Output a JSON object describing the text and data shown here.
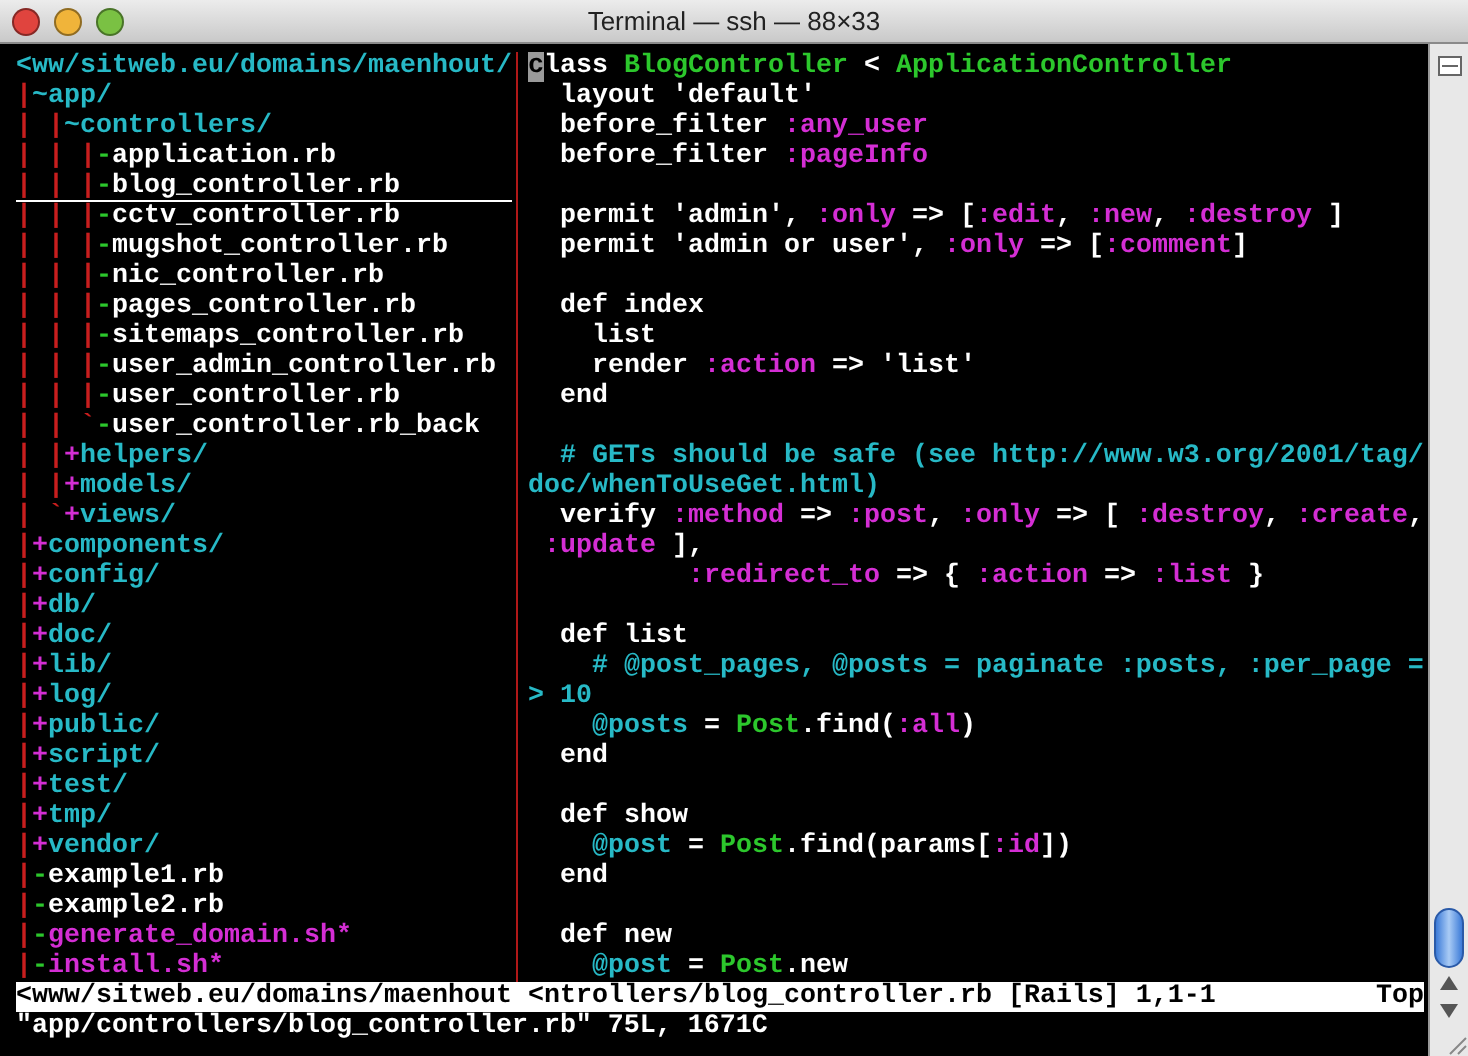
{
  "window": {
    "title": "Terminal — ssh — 88×33"
  },
  "tree_pane": {
    "lines": [
      {
        "cursor_line": false,
        "segments": [
          {
            "text": "<ww/sitweb.eu/domains/maenhout/",
            "color": "#27b9c6"
          }
        ]
      },
      {
        "cursor_line": false,
        "segments": [
          {
            "text": "|",
            "color": "#c81e1e"
          },
          {
            "text": "~app/",
            "color": "#27b9c6"
          }
        ]
      },
      {
        "cursor_line": false,
        "segments": [
          {
            "text": "| |",
            "color": "#c81e1e"
          },
          {
            "text": "~controllers/",
            "color": "#27b9c6"
          }
        ]
      },
      {
        "cursor_line": false,
        "segments": [
          {
            "text": "| | |",
            "color": "#c81e1e"
          },
          {
            "text": "-",
            "color": "#2cc72c"
          },
          {
            "text": "application.rb",
            "color": "#ffffff"
          }
        ]
      },
      {
        "cursor_line": true,
        "segments": [
          {
            "text": "| | |",
            "color": "#c81e1e"
          },
          {
            "text": "-",
            "color": "#2cc72c"
          },
          {
            "text": "blog_controller.rb",
            "color": "#ffffff"
          }
        ]
      },
      {
        "cursor_line": false,
        "segments": [
          {
            "text": "| | |",
            "color": "#c81e1e"
          },
          {
            "text": "-",
            "color": "#2cc72c"
          },
          {
            "text": "cctv_controller.rb",
            "color": "#ffffff"
          }
        ]
      },
      {
        "cursor_line": false,
        "segments": [
          {
            "text": "| | |",
            "color": "#c81e1e"
          },
          {
            "text": "-",
            "color": "#2cc72c"
          },
          {
            "text": "mugshot_controller.rb",
            "color": "#ffffff"
          }
        ]
      },
      {
        "cursor_line": false,
        "segments": [
          {
            "text": "| | |",
            "color": "#c81e1e"
          },
          {
            "text": "-",
            "color": "#2cc72c"
          },
          {
            "text": "nic_controller.rb",
            "color": "#ffffff"
          }
        ]
      },
      {
        "cursor_line": false,
        "segments": [
          {
            "text": "| | |",
            "color": "#c81e1e"
          },
          {
            "text": "-",
            "color": "#2cc72c"
          },
          {
            "text": "pages_controller.rb",
            "color": "#ffffff"
          }
        ]
      },
      {
        "cursor_line": false,
        "segments": [
          {
            "text": "| | |",
            "color": "#c81e1e"
          },
          {
            "text": "-",
            "color": "#2cc72c"
          },
          {
            "text": "sitemaps_controller.rb",
            "color": "#ffffff"
          }
        ]
      },
      {
        "cursor_line": false,
        "segments": [
          {
            "text": "| | |",
            "color": "#c81e1e"
          },
          {
            "text": "-",
            "color": "#2cc72c"
          },
          {
            "text": "user_admin_controller.rb",
            "color": "#ffffff"
          }
        ]
      },
      {
        "cursor_line": false,
        "segments": [
          {
            "text": "| | |",
            "color": "#c81e1e"
          },
          {
            "text": "-",
            "color": "#2cc72c"
          },
          {
            "text": "user_controller.rb",
            "color": "#ffffff"
          }
        ]
      },
      {
        "cursor_line": false,
        "segments": [
          {
            "text": "| | `",
            "color": "#c81e1e"
          },
          {
            "text": "-",
            "color": "#2cc72c"
          },
          {
            "text": "user_controller.rb_back",
            "color": "#ffffff"
          }
        ]
      },
      {
        "cursor_line": false,
        "segments": [
          {
            "text": "| |",
            "color": "#c81e1e"
          },
          {
            "text": "+",
            "color": "#d42ed4"
          },
          {
            "text": "helpers/",
            "color": "#27b9c6"
          }
        ]
      },
      {
        "cursor_line": false,
        "segments": [
          {
            "text": "| |",
            "color": "#c81e1e"
          },
          {
            "text": "+",
            "color": "#d42ed4"
          },
          {
            "text": "models/",
            "color": "#27b9c6"
          }
        ]
      },
      {
        "cursor_line": false,
        "segments": [
          {
            "text": "| `",
            "color": "#c81e1e"
          },
          {
            "text": "+",
            "color": "#d42ed4"
          },
          {
            "text": "views/",
            "color": "#27b9c6"
          }
        ]
      },
      {
        "cursor_line": false,
        "segments": [
          {
            "text": "|",
            "color": "#c81e1e"
          },
          {
            "text": "+",
            "color": "#d42ed4"
          },
          {
            "text": "components/",
            "color": "#27b9c6"
          }
        ]
      },
      {
        "cursor_line": false,
        "segments": [
          {
            "text": "|",
            "color": "#c81e1e"
          },
          {
            "text": "+",
            "color": "#d42ed4"
          },
          {
            "text": "config/",
            "color": "#27b9c6"
          }
        ]
      },
      {
        "cursor_line": false,
        "segments": [
          {
            "text": "|",
            "color": "#c81e1e"
          },
          {
            "text": "+",
            "color": "#d42ed4"
          },
          {
            "text": "db/",
            "color": "#27b9c6"
          }
        ]
      },
      {
        "cursor_line": false,
        "segments": [
          {
            "text": "|",
            "color": "#c81e1e"
          },
          {
            "text": "+",
            "color": "#d42ed4"
          },
          {
            "text": "doc/",
            "color": "#27b9c6"
          }
        ]
      },
      {
        "cursor_line": false,
        "segments": [
          {
            "text": "|",
            "color": "#c81e1e"
          },
          {
            "text": "+",
            "color": "#d42ed4"
          },
          {
            "text": "lib/",
            "color": "#27b9c6"
          }
        ]
      },
      {
        "cursor_line": false,
        "segments": [
          {
            "text": "|",
            "color": "#c81e1e"
          },
          {
            "text": "+",
            "color": "#d42ed4"
          },
          {
            "text": "log/",
            "color": "#27b9c6"
          }
        ]
      },
      {
        "cursor_line": false,
        "segments": [
          {
            "text": "|",
            "color": "#c81e1e"
          },
          {
            "text": "+",
            "color": "#d42ed4"
          },
          {
            "text": "public/",
            "color": "#27b9c6"
          }
        ]
      },
      {
        "cursor_line": false,
        "segments": [
          {
            "text": "|",
            "color": "#c81e1e"
          },
          {
            "text": "+",
            "color": "#d42ed4"
          },
          {
            "text": "script/",
            "color": "#27b9c6"
          }
        ]
      },
      {
        "cursor_line": false,
        "segments": [
          {
            "text": "|",
            "color": "#c81e1e"
          },
          {
            "text": "+",
            "color": "#d42ed4"
          },
          {
            "text": "test/",
            "color": "#27b9c6"
          }
        ]
      },
      {
        "cursor_line": false,
        "segments": [
          {
            "text": "|",
            "color": "#c81e1e"
          },
          {
            "text": "+",
            "color": "#d42ed4"
          },
          {
            "text": "tmp/",
            "color": "#27b9c6"
          }
        ]
      },
      {
        "cursor_line": false,
        "segments": [
          {
            "text": "|",
            "color": "#c81e1e"
          },
          {
            "text": "+",
            "color": "#d42ed4"
          },
          {
            "text": "vendor/",
            "color": "#27b9c6"
          }
        ]
      },
      {
        "cursor_line": false,
        "segments": [
          {
            "text": "|",
            "color": "#c81e1e"
          },
          {
            "text": "-",
            "color": "#2cc72c"
          },
          {
            "text": "example1.rb",
            "color": "#ffffff"
          }
        ]
      },
      {
        "cursor_line": false,
        "segments": [
          {
            "text": "|",
            "color": "#c81e1e"
          },
          {
            "text": "-",
            "color": "#2cc72c"
          },
          {
            "text": "example2.rb",
            "color": "#ffffff"
          }
        ]
      },
      {
        "cursor_line": false,
        "segments": [
          {
            "text": "|",
            "color": "#c81e1e"
          },
          {
            "text": "-",
            "color": "#2cc72c"
          },
          {
            "text": "generate_domain.sh*",
            "color": "#d42ed4"
          }
        ]
      },
      {
        "cursor_line": false,
        "segments": [
          {
            "text": "|",
            "color": "#c81e1e"
          },
          {
            "text": "-",
            "color": "#2cc72c"
          },
          {
            "text": "install.sh*",
            "color": "#d42ed4"
          }
        ]
      }
    ]
  },
  "code_pane": {
    "blocks": [
      {
        "lines": [
          {
            "segments": [
              {
                "text": "c",
                "cursor": true
              },
              {
                "text": "lass ",
                "color": "#ffffff"
              },
              {
                "text": "BlogController",
                "color": "#2cc72c"
              },
              {
                "text": " < ",
                "color": "#ffffff"
              },
              {
                "text": "ApplicationController",
                "color": "#2cc72c"
              }
            ]
          },
          {
            "segments": [
              {
                "text": "  layout 'default'",
                "color": "#ffffff"
              }
            ]
          },
          {
            "segments": [
              {
                "text": "  before_filter ",
                "color": "#ffffff"
              },
              {
                "text": ":any_user",
                "color": "#d42ed4"
              }
            ]
          },
          {
            "segments": [
              {
                "text": "  before_filter ",
                "color": "#ffffff"
              },
              {
                "text": ":pageInfo",
                "color": "#d42ed4"
              }
            ]
          }
        ]
      },
      {
        "lines": [
          {
            "segments": [
              {
                "text": "  permit 'admin', ",
                "color": "#ffffff"
              },
              {
                "text": ":only",
                "color": "#d42ed4"
              },
              {
                "text": " => [",
                "color": "#ffffff"
              },
              {
                "text": ":edit",
                "color": "#d42ed4"
              },
              {
                "text": ", ",
                "color": "#ffffff"
              },
              {
                "text": ":new",
                "color": "#d42ed4"
              },
              {
                "text": ", ",
                "color": "#ffffff"
              },
              {
                "text": ":destroy",
                "color": "#d42ed4"
              },
              {
                "text": " ]",
                "color": "#ffffff"
              }
            ]
          },
          {
            "segments": [
              {
                "text": "  permit 'admin or user', ",
                "color": "#ffffff"
              },
              {
                "text": ":only",
                "color": "#d42ed4"
              },
              {
                "text": " => [",
                "color": "#ffffff"
              },
              {
                "text": ":comment",
                "color": "#d42ed4"
              },
              {
                "text": "]",
                "color": "#ffffff"
              }
            ]
          }
        ]
      },
      {
        "lines": [
          {
            "segments": [
              {
                "text": "  def index",
                "color": "#ffffff"
              }
            ]
          },
          {
            "segments": [
              {
                "text": "    list",
                "color": "#ffffff"
              }
            ]
          },
          {
            "segments": [
              {
                "text": "    render ",
                "color": "#ffffff"
              },
              {
                "text": ":action",
                "color": "#d42ed4"
              },
              {
                "text": " => 'list'",
                "color": "#ffffff"
              }
            ]
          },
          {
            "segments": [
              {
                "text": "  end",
                "color": "#ffffff"
              }
            ]
          }
        ]
      },
      {
        "lines": [
          {
            "segments": [
              {
                "text": "  # GETs should be safe (see http://www.w3.org/2001/tag/",
                "color": "#27b9c6"
              }
            ]
          },
          {
            "segments": [
              {
                "text": "doc/whenToUseGet.html)",
                "color": "#27b9c6"
              }
            ]
          },
          {
            "segments": [
              {
                "text": "  verify ",
                "color": "#ffffff"
              },
              {
                "text": ":method",
                "color": "#d42ed4"
              },
              {
                "text": " => ",
                "color": "#ffffff"
              },
              {
                "text": ":post",
                "color": "#d42ed4"
              },
              {
                "text": ", ",
                "color": "#ffffff"
              },
              {
                "text": ":only",
                "color": "#d42ed4"
              },
              {
                "text": " => [ ",
                "color": "#ffffff"
              },
              {
                "text": ":destroy",
                "color": "#d42ed4"
              },
              {
                "text": ", ",
                "color": "#ffffff"
              },
              {
                "text": ":create",
                "color": "#d42ed4"
              },
              {
                "text": ",",
                "color": "#ffffff"
              }
            ]
          },
          {
            "segments": [
              {
                "text": " :update",
                "color": "#d42ed4"
              },
              {
                "text": " ],",
                "color": "#ffffff"
              }
            ]
          },
          {
            "segments": [
              {
                "text": "          :redirect_to",
                "color": "#d42ed4"
              },
              {
                "text": " => { ",
                "color": "#ffffff"
              },
              {
                "text": ":action",
                "color": "#d42ed4"
              },
              {
                "text": " => ",
                "color": "#ffffff"
              },
              {
                "text": ":list",
                "color": "#d42ed4"
              },
              {
                "text": " }",
                "color": "#ffffff"
              }
            ]
          }
        ]
      },
      {
        "lines": [
          {
            "segments": [
              {
                "text": "  def list",
                "color": "#ffffff"
              }
            ]
          },
          {
            "segments": [
              {
                "text": "    # @post_pages, @posts = paginate :posts, :per_page =",
                "color": "#27b9c6"
              }
            ]
          },
          {
            "segments": [
              {
                "text": "> 10",
                "color": "#27b9c6"
              }
            ]
          },
          {
            "segments": [
              {
                "text": "    @posts",
                "color": "#27b9c6"
              },
              {
                "text": " = ",
                "color": "#ffffff"
              },
              {
                "text": "Post",
                "color": "#2cc72c"
              },
              {
                "text": ".find(",
                "color": "#ffffff"
              },
              {
                "text": ":all",
                "color": "#d42ed4"
              },
              {
                "text": ")",
                "color": "#ffffff"
              }
            ]
          },
          {
            "segments": [
              {
                "text": "  end",
                "color": "#ffffff"
              }
            ]
          }
        ]
      },
      {
        "lines": [
          {
            "segments": [
              {
                "text": "  def show",
                "color": "#ffffff"
              }
            ]
          },
          {
            "segments": [
              {
                "text": "    @post",
                "color": "#27b9c6"
              },
              {
                "text": " = ",
                "color": "#ffffff"
              },
              {
                "text": "Post",
                "color": "#2cc72c"
              },
              {
                "text": ".find(params[",
                "color": "#ffffff"
              },
              {
                "text": ":id",
                "color": "#d42ed4"
              },
              {
                "text": "])",
                "color": "#ffffff"
              }
            ]
          },
          {
            "segments": [
              {
                "text": "  end",
                "color": "#ffffff"
              }
            ]
          }
        ]
      },
      {
        "lines": [
          {
            "segments": [
              {
                "text": "  def new",
                "color": "#ffffff"
              }
            ]
          },
          {
            "segments": [
              {
                "text": "    @post",
                "color": "#27b9c6"
              },
              {
                "text": " = ",
                "color": "#ffffff"
              },
              {
                "text": "Post",
                "color": "#2cc72c"
              },
              {
                "text": ".new",
                "color": "#ffffff"
              }
            ]
          }
        ]
      }
    ]
  },
  "status_line": {
    "left": "<www/sitweb.eu/domains/maenhout",
    "right": "<ntrollers/blog_controller.rb [Rails] 1,1-1",
    "position": "Top"
  },
  "message_line": "\"app/controllers/blog_controller.rb\" 75L, 1671C"
}
